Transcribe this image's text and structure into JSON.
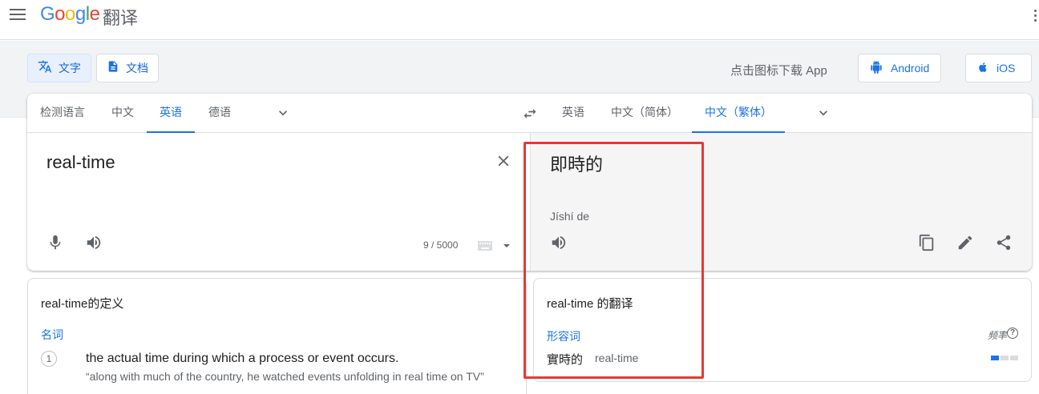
{
  "header": {
    "logo_letters": [
      "G",
      "o",
      "o",
      "g",
      "l",
      "e"
    ],
    "product": "翻译"
  },
  "modes": {
    "text_label": "文字",
    "docs_label": "文档"
  },
  "download": {
    "text": "点击图标下载 App",
    "android_label": "Android",
    "ios_label": "iOS"
  },
  "source_langs": [
    "检测语言",
    "中文",
    "英语",
    "德语"
  ],
  "source_active": 2,
  "target_langs": [
    "英语",
    "中文（简体）",
    "中文（繁体）"
  ],
  "target_active": 2,
  "source": {
    "text": "real-time",
    "char_count": "9 / 5000"
  },
  "target": {
    "text": "即時的",
    "romanization": "Jíshí de"
  },
  "definitions": {
    "title": "real-time的定义",
    "part_of_speech": "名词",
    "items": [
      {
        "number": "1",
        "definition": "the actual time during which a process or event occurs.",
        "example": "“along with much of the country, he watched events unfolding in real time on TV”"
      }
    ]
  },
  "translations": {
    "title": "real-time 的翻译",
    "part_of_speech": "形容词",
    "frequency_label": "频率",
    "help_glyph": "?",
    "word": "實時的",
    "back_translation": "real-time",
    "frequency_level": 1,
    "frequency_max": 3
  },
  "colors": {
    "accent": "#1a73e8",
    "highlight": "#e53935"
  }
}
